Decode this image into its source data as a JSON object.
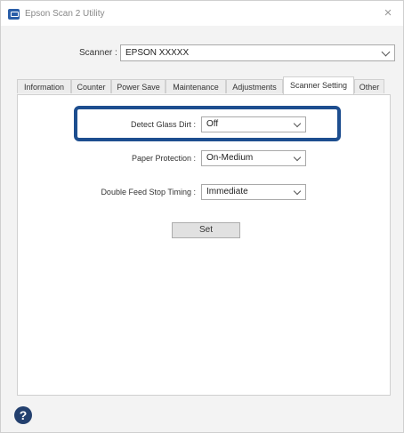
{
  "window": {
    "title": "Epson Scan 2 Utility",
    "close_glyph": "×"
  },
  "scanner": {
    "label": "Scanner :",
    "value": "EPSON XXXXX"
  },
  "tabs": [
    {
      "label": "Information"
    },
    {
      "label": "Counter"
    },
    {
      "label": "Power Save"
    },
    {
      "label": "Maintenance"
    },
    {
      "label": "Adjustments"
    },
    {
      "label": "Scanner Setting"
    },
    {
      "label": "Other"
    }
  ],
  "active_tab": "Scanner Setting",
  "settings": {
    "detect_glass_dirt": {
      "label": "Detect Glass Dirt :",
      "value": "Off"
    },
    "paper_protection": {
      "label": "Paper Protection :",
      "value": "On-Medium"
    },
    "double_feed_stop_timing": {
      "label": "Double Feed Stop Timing :",
      "value": "Immediate"
    }
  },
  "set_button": {
    "label": "Set"
  },
  "help": {
    "glyph": "?"
  },
  "colors": {
    "highlight": "#1d4e8f",
    "help_icon": "#23406e",
    "app_icon": "#2a5ea8"
  }
}
